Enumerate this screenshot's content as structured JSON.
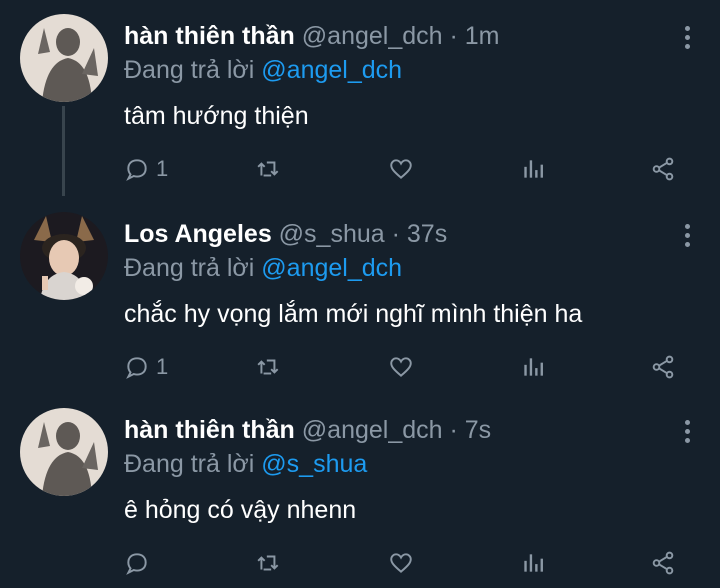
{
  "tweets": [
    {
      "name": "hàn thiên thần",
      "handle": "@angel_dch",
      "dot": "·",
      "time": "1m",
      "reply_prefix": "Đang trả lời",
      "reply_to": "@angel_dch",
      "text": "tâm hướng thiện",
      "reply_count": "1"
    },
    {
      "name": "Los Angeles",
      "handle": "@s_shua",
      "dot": "·",
      "time": "37s",
      "reply_prefix": "Đang trả lời",
      "reply_to": "@angel_dch",
      "text": "chắc hy vọng lắm mới nghĩ mình thiện ha",
      "reply_count": "1"
    },
    {
      "name": "hàn thiên thần",
      "handle": "@angel_dch",
      "dot": "·",
      "time": "7s",
      "reply_prefix": "Đang trả lời",
      "reply_to": "@s_shua",
      "text": "ê hỏng có vậy nhenn",
      "reply_count": ""
    }
  ],
  "colors": {
    "background": "#15202b",
    "link": "#1d9bf0",
    "muted": "#8b98a5"
  },
  "icons": [
    "reply-icon",
    "retweet-icon",
    "like-icon",
    "analytics-icon",
    "share-icon",
    "more-icon"
  ]
}
